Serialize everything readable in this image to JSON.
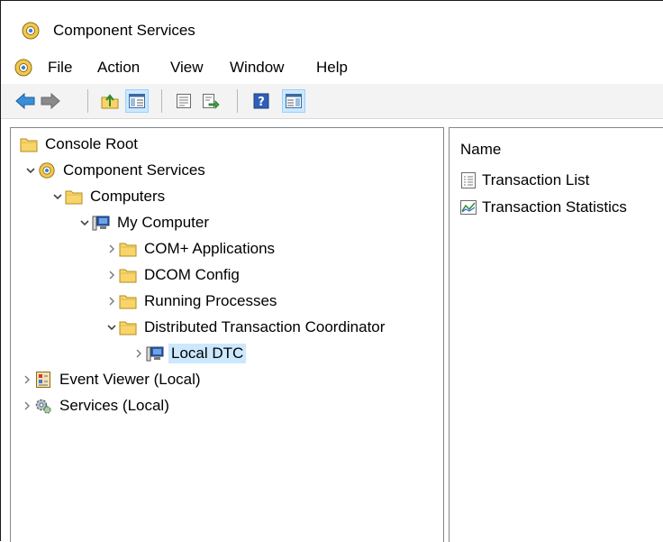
{
  "window": {
    "title": "Component Services"
  },
  "menu": [
    "File",
    "Action",
    "View",
    "Window",
    "Help"
  ],
  "toolbar": [
    {
      "name": "back-button",
      "icon": "back-arrow-icon"
    },
    {
      "name": "forward-button",
      "icon": "forward-arrow-icon"
    },
    {
      "name": "up-one-level-button",
      "icon": "up-folder-icon"
    },
    {
      "name": "show-hide-console-tree-button",
      "icon": "console-tree-icon",
      "active": true
    },
    {
      "name": "properties-button",
      "icon": "properties-icon"
    },
    {
      "name": "export-list-button",
      "icon": "export-icon"
    },
    {
      "name": "help-button",
      "icon": "help-icon"
    },
    {
      "name": "show-hide-action-pane-button",
      "icon": "action-pane-icon",
      "active": true
    }
  ],
  "tree": [
    {
      "label": "Console Root",
      "icon": "folder-icon",
      "level": 0,
      "expander": "none"
    },
    {
      "label": "Component Services",
      "icon": "component-services-icon",
      "level": 1,
      "expander": "expanded"
    },
    {
      "label": "Computers",
      "icon": "folder-icon",
      "level": 2,
      "expander": "expanded"
    },
    {
      "label": "My Computer",
      "icon": "computer-icon",
      "level": 3,
      "expander": "expanded"
    },
    {
      "label": "COM+ Applications",
      "icon": "folder-icon",
      "level": 4,
      "expander": "collapsed"
    },
    {
      "label": "DCOM Config",
      "icon": "folder-icon",
      "level": 4,
      "expander": "collapsed"
    },
    {
      "label": "Running Processes",
      "icon": "folder-icon",
      "level": 4,
      "expander": "collapsed"
    },
    {
      "label": "Distributed Transaction Coordinator",
      "icon": "folder-icon",
      "level": 4,
      "expander": "expanded"
    },
    {
      "label": "Local DTC",
      "icon": "computer-icon",
      "level": 5,
      "expander": "collapsed",
      "selected": true
    },
    {
      "label": "Event Viewer (Local)",
      "icon": "event-viewer-icon",
      "level": 0,
      "expander": "collapsed"
    },
    {
      "label": "Services (Local)",
      "icon": "services-gear-icon",
      "level": 0,
      "expander": "collapsed"
    }
  ],
  "list": {
    "column_header": "Name",
    "items": [
      {
        "label": "Transaction List",
        "icon": "list-document-icon"
      },
      {
        "label": "Transaction Statistics",
        "icon": "statistics-chart-icon"
      }
    ]
  }
}
